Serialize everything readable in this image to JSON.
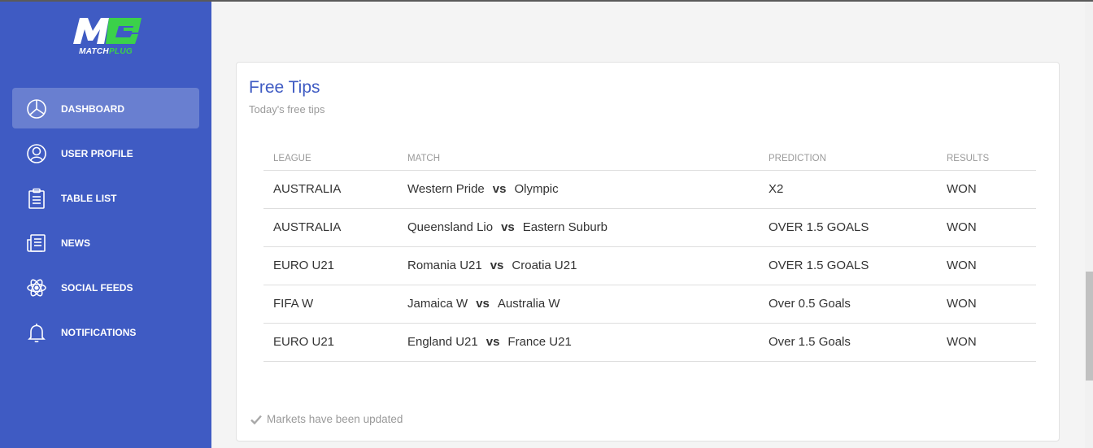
{
  "brand": {
    "logo_text": "MATCH",
    "logo_text_accent": "PLUG"
  },
  "sidebar": {
    "items": [
      {
        "label": "DASHBOARD",
        "icon": "pie-chart-icon",
        "active": true
      },
      {
        "label": "USER PROFILE",
        "icon": "user-icon",
        "active": false
      },
      {
        "label": "TABLE LIST",
        "icon": "clipboard-list-icon",
        "active": false
      },
      {
        "label": "NEWS",
        "icon": "newspaper-icon",
        "active": false
      },
      {
        "label": "SOCIAL FEEDS",
        "icon": "atom-icon",
        "active": false
      },
      {
        "label": "NOTIFICATIONS",
        "icon": "bell-icon",
        "active": false
      }
    ]
  },
  "card": {
    "title": "Free Tips",
    "subtitle": "Today's free tips",
    "columns": [
      "LEAGUE",
      "MATCH",
      "PREDICTION",
      "RESULTS"
    ],
    "rows": [
      {
        "league": "AUSTRALIA",
        "home": "Western Pride",
        "vs": "vs",
        "away": "Olympic",
        "prediction": "X2",
        "result": "WON"
      },
      {
        "league": "AUSTRALIA",
        "home": "Queensland Lio",
        "vs": "vs",
        "away": "Eastern Suburb",
        "prediction": "OVER 1.5 GOALS",
        "result": "WON"
      },
      {
        "league": "EURO U21",
        "home": "Romania U21",
        "vs": "vs",
        "away": "Croatia U21",
        "prediction": "OVER 1.5 GOALS",
        "result": "WON"
      },
      {
        "league": "FIFA W",
        "home": "Jamaica W",
        "vs": "vs",
        "away": "Australia W",
        "prediction": "Over 0.5 Goals",
        "result": "WON"
      },
      {
        "league": "EURO U21",
        "home": "England U21",
        "vs": "vs",
        "away": "France U21",
        "prediction": "Over 1.5 Goals",
        "result": "WON"
      }
    ],
    "footer_text": "Markets have been updated"
  },
  "colors": {
    "sidebar_bg": "#3f5bc3",
    "accent": "#3f5bc3",
    "logo_green": "#3bd14a"
  }
}
